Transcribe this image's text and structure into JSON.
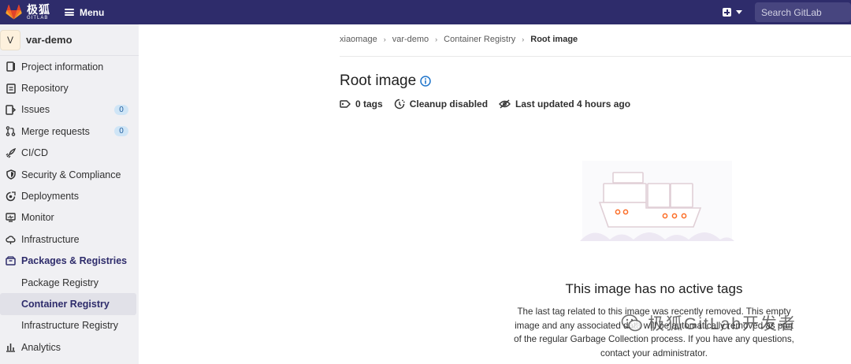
{
  "topbar": {
    "logo_cn": "极狐",
    "logo_en": "GITLAB",
    "menu_label": "Menu",
    "search_placeholder": "Search GitLab",
    "brand_color": "#2e2c6b"
  },
  "sidebar": {
    "avatar_letter": "V",
    "project_name": "var-demo",
    "items": [
      {
        "label": "Project information",
        "icon": "project-information-icon"
      },
      {
        "label": "Repository",
        "icon": "repository-icon"
      },
      {
        "label": "Issues",
        "icon": "issues-icon",
        "badge": "0"
      },
      {
        "label": "Merge requests",
        "icon": "merge-requests-icon",
        "badge": "0"
      },
      {
        "label": "CI/CD",
        "icon": "rocket-icon"
      },
      {
        "label": "Security & Compliance",
        "icon": "shield-icon"
      },
      {
        "label": "Deployments",
        "icon": "deployments-icon"
      },
      {
        "label": "Monitor",
        "icon": "monitor-icon"
      },
      {
        "label": "Infrastructure",
        "icon": "cloud-icon"
      },
      {
        "label": "Packages & Registries",
        "icon": "package-icon"
      }
    ],
    "sub_items": [
      {
        "label": "Package Registry"
      },
      {
        "label": "Container Registry"
      },
      {
        "label": "Infrastructure Registry"
      }
    ],
    "last_item": {
      "label": "Analytics",
      "icon": "analytics-icon"
    }
  },
  "breadcrumb": {
    "items": [
      "xiaomage",
      "var-demo",
      "Container Registry"
    ],
    "current": "Root image"
  },
  "page": {
    "title": "Root image",
    "tags": "0 tags",
    "cleanup": "Cleanup disabled",
    "last_updated": "Last updated 4 hours ago"
  },
  "empty_state": {
    "title": "This image has no active tags",
    "description": "The last tag related to this image was recently removed. This empty image and any associated data will be automatically removed as part of the regular Garbage Collection process. If you have any questions, contact your administrator."
  },
  "watermark": {
    "text": "极狐GitLab开发者"
  }
}
